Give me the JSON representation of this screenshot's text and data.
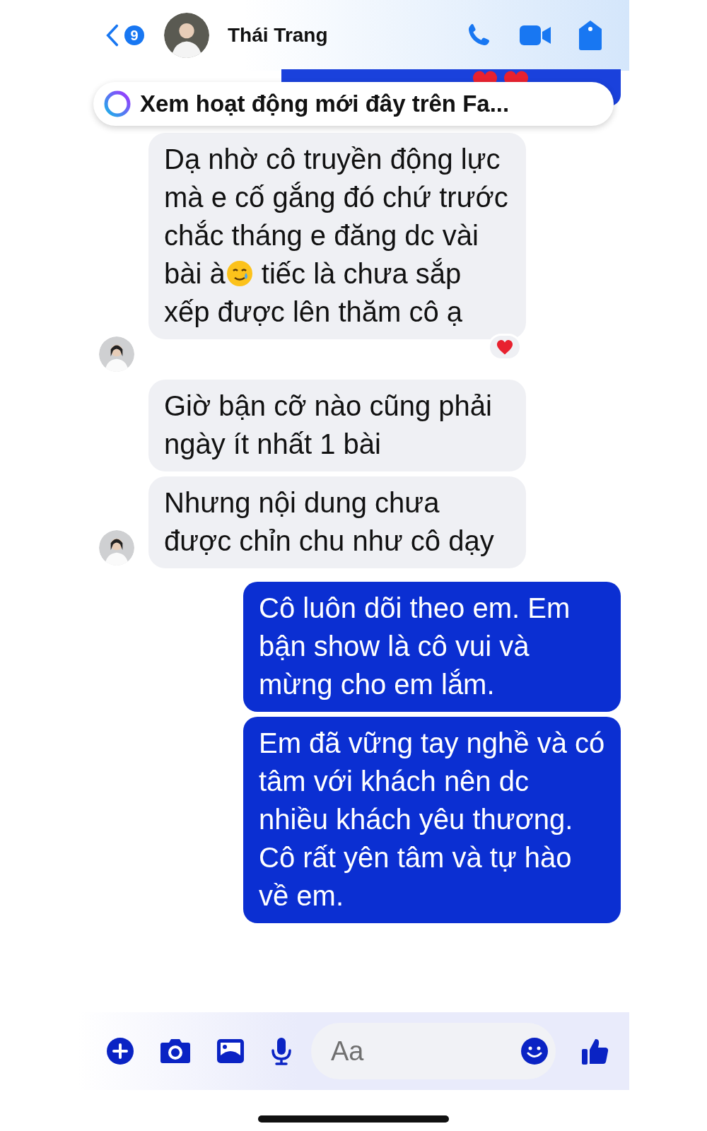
{
  "header": {
    "back_count": "9",
    "contact_name": "Thái Trang"
  },
  "banner": {
    "text": "Xem hoạt động mới đây trên Fa..."
  },
  "messages": [
    {
      "kind": "received",
      "show_avatar": true,
      "reaction": true,
      "parts": [
        {
          "kind": "text",
          "text": "Dạ nhờ cô truyền động lực mà e cố gắng đó chứ trước chắc tháng e đăng dc vài bài à"
        },
        {
          "kind": "emoji"
        },
        {
          "kind": "text",
          "text": " tiếc là chưa sắp xếp được lên thăm cô ạ"
        }
      ]
    },
    {
      "kind": "received",
      "show_avatar": false,
      "reaction": false,
      "parts": [
        {
          "kind": "text",
          "text": "Giờ bận cỡ nào cũng phải ngày ít nhất 1 bài"
        }
      ]
    },
    {
      "kind": "received",
      "show_avatar": true,
      "reaction": false,
      "parts": [
        {
          "kind": "text",
          "text": "Nhưng nội dung chưa được chỉn chu như cô dạy"
        }
      ]
    },
    {
      "kind": "sent",
      "reaction": false,
      "parts": [
        {
          "kind": "text",
          "text": "Cô luôn dõi theo em. Em bận show là cô vui và mừng cho em lắm."
        }
      ]
    },
    {
      "kind": "sent",
      "reaction": false,
      "parts": [
        {
          "kind": "text",
          "text": "Em đã vững tay nghề và có tâm với khách nên dc nhiều khách yêu thương. Cô rất yên tâm và tự hào về em."
        }
      ]
    }
  ],
  "composer": {
    "placeholder": "Aa"
  }
}
